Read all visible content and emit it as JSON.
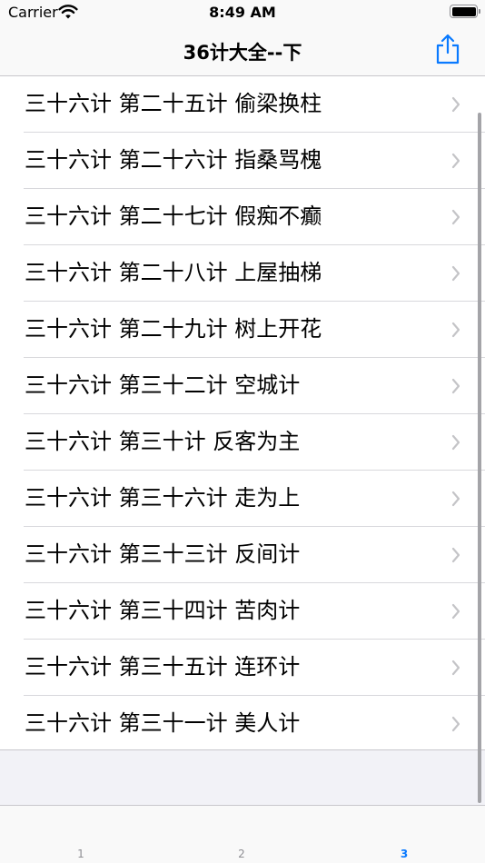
{
  "status": {
    "carrier": "Carrier",
    "time": "8:49 AM"
  },
  "nav": {
    "title": "36计大全--下",
    "share_icon": "share-icon"
  },
  "list": {
    "items": [
      "三十六计 第二十五计 偷梁换柱",
      "三十六计 第二十六计 指桑骂槐",
      "三十六计 第二十七计 假痴不癫",
      "三十六计 第二十八计 上屋抽梯",
      "三十六计 第二十九计 树上开花",
      "三十六计 第三十二计 空城计",
      "三十六计 第三十计 反客为主",
      "三十六计 第三十六计 走为上",
      "三十六计 第三十三计 反间计",
      "三十六计 第三十四计 苦肉计",
      "三十六计 第三十五计 连环计",
      "三十六计 第三十一计 美人计"
    ]
  },
  "tabs": [
    {
      "label": "1",
      "active": false
    },
    {
      "label": "2",
      "active": false
    },
    {
      "label": "3",
      "active": true
    }
  ],
  "colors": {
    "accent": "#0a7aff",
    "chevron": "#c4c4c7",
    "separator": "#d8d8dc"
  }
}
